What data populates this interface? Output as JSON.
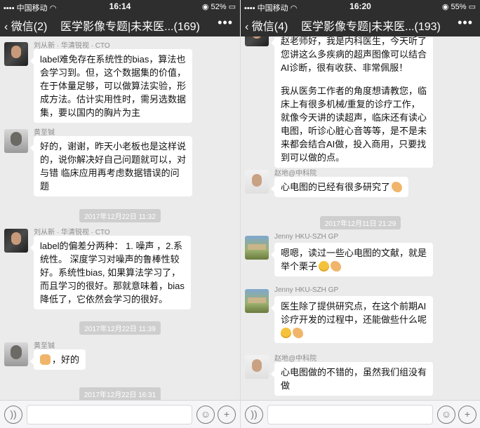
{
  "phones": [
    {
      "status": {
        "carrier": "中国移动",
        "time": "16:14",
        "battery": "52%"
      },
      "nav": {
        "back": "微信(2)",
        "title": "医学影像专题|未来医...(169)",
        "more": "•••"
      },
      "messages": [
        {
          "name": "刘从新 · 华清锐视 · CTO",
          "lines": [
            "label难免存在系统性的bias，算法也",
            "会学习到。但，这个数据集的价值，",
            "在于体量足够，可以做算法实验，形",
            "成方法。估计实用性时，需另选数据",
            "集，要以国内的胸片为主"
          ]
        },
        {
          "name": "黄至铖",
          "lines": [
            "好的，谢谢，昨天小老板也是这样说",
            "的，说你解决好自己问题就可以，对",
            "与错 临床应用再考虑数据错误的问",
            "题"
          ]
        },
        {
          "time": "2017年12月22日 11:32"
        },
        {
          "name": "刘从新 · 华清锐视 · CTO",
          "lines": [
            "label的偏差分两种：  1. 噪声 ，2.系",
            "统性。 深度学习对噪声的鲁棒性较",
            "好。系统性bias, 如果算法学习了，",
            "而且学习的很好。那就意味着，bias",
            "降低了，它依然会学习的很好。"
          ]
        },
        {
          "time": "2017年12月22日 11:39"
        },
        {
          "name": "黄至铖",
          "lines": [
            "，好的"
          ]
        },
        {
          "time": "2017年12月22日 16:31"
        }
      ]
    },
    {
      "status": {
        "carrier": "中国移动",
        "time": "16:20",
        "battery": "55%"
      },
      "nav": {
        "back": "微信(4)",
        "title": "医学影像专题|未来医...(193)",
        "more": "•••"
      },
      "messages": [
        {
          "lines": [
            "赵老师好，我是内科医生，今天听了",
            "您讲这么多疾病的超声图像可以结合",
            "AI诊断，很有收获、非常佩服！",
            "",
            "我从医务工作者的角度想请教您，临",
            "床上有很多机械/重复的诊疗工作，",
            "就像今天讲的读超声，临床还有读心",
            "电图，听诊心脏心音等等，是不是未",
            "来都会结合AI做，投入商用，只要找",
            "到可以做的点。"
          ]
        },
        {
          "name": "赵地@中科院",
          "lines": [
            "心电图的已经有很多研究了"
          ]
        },
        {
          "time": "2017年12月11日 21:29"
        },
        {
          "name": "Jenny HKU-SZH GP",
          "lines": [
            "嗯嗯，读过一些心电图的文献，就是",
            "举个栗子"
          ]
        },
        {
          "name": "Jenny HKU-SZH GP",
          "lines": [
            "医生除了提供研究点，在这个前期AI",
            "诊疗开发的过程中，还能做些什么呢",
            ""
          ]
        },
        {
          "name": "赵地@中科院",
          "lines": [
            "心电图做的不错的，虽然我们组没有",
            "做"
          ]
        }
      ]
    }
  ],
  "icons": {
    "back": "chevron-left-icon",
    "more": "more-dots-icon",
    "voice": "voice-icon",
    "emoji": "emoji-icon",
    "add": "plus-circle-icon"
  },
  "colors": {
    "nav_bg": "#2e2e2e",
    "chat_bg": "#ebebeb",
    "bubble_bg": "#ffffff",
    "time_chip_bg": "#cecece"
  }
}
